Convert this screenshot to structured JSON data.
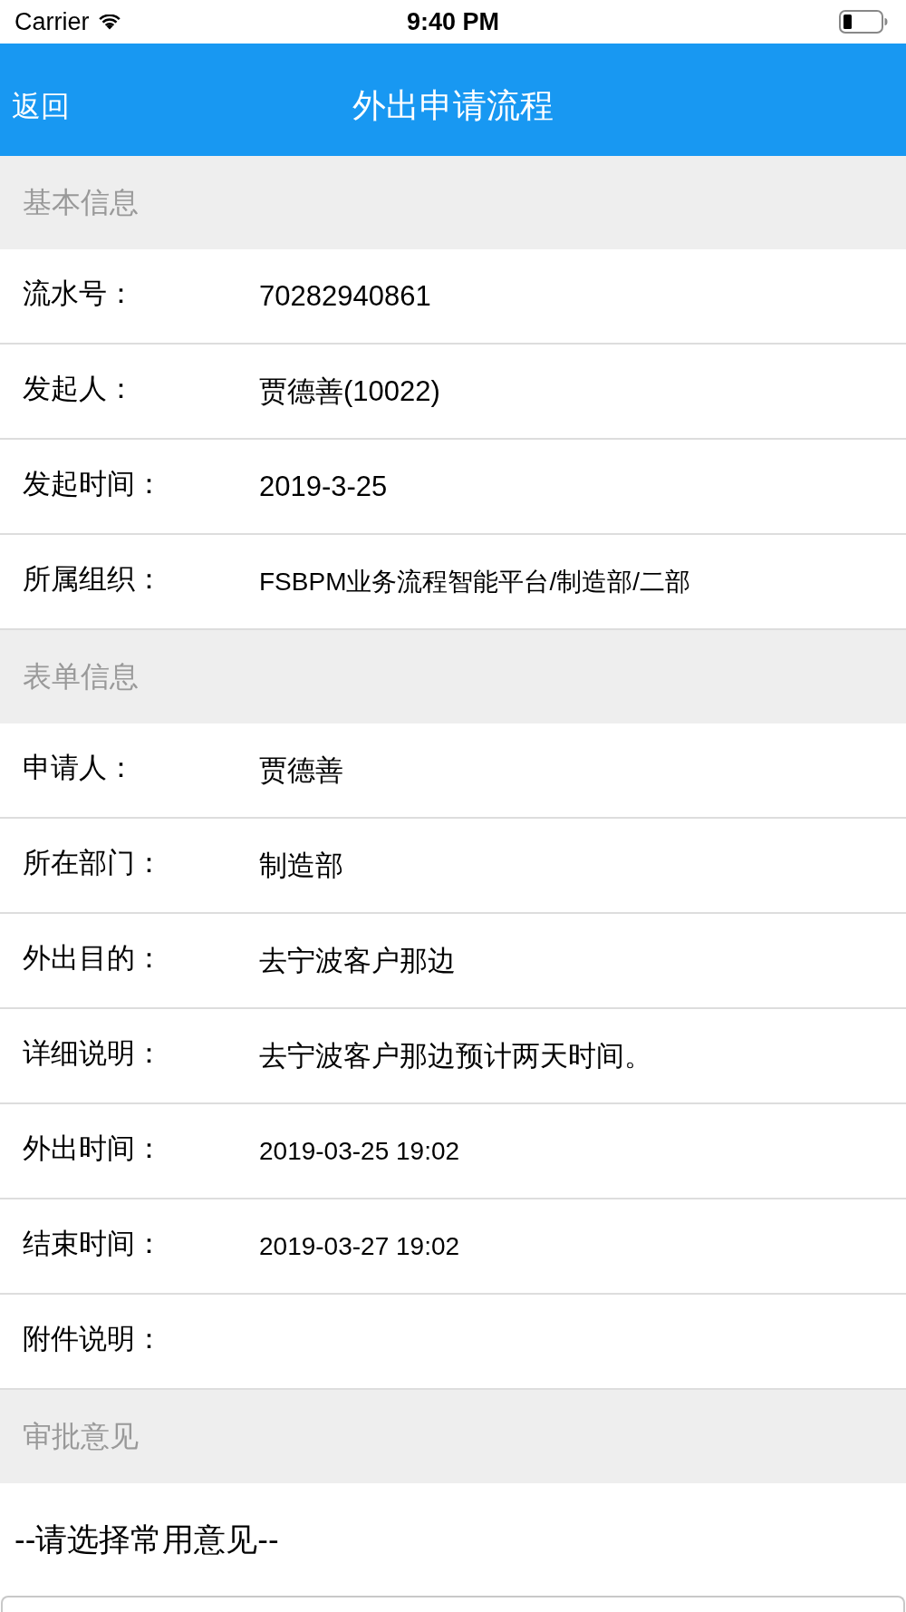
{
  "status_bar": {
    "carrier": "Carrier",
    "time": "9:40 PM"
  },
  "nav_bar": {
    "back": "返回",
    "title": "外出申请流程"
  },
  "sections": [
    {
      "title": "基本信息",
      "fields": [
        {
          "label": "流水号：",
          "value": "70282940861"
        },
        {
          "label": "发起人：",
          "value": "贾德善(10022)"
        },
        {
          "label": "发起时间：",
          "value": "2019-3-25"
        },
        {
          "label": "所属组织：",
          "value": "FSBPM业务流程智能平台/制造部/二部"
        }
      ]
    },
    {
      "title": "表单信息",
      "fields": [
        {
          "label": "申请人：",
          "value": "贾德善"
        },
        {
          "label": "所在部门：",
          "value": "制造部"
        },
        {
          "label": "外出目的：",
          "value": "去宁波客户那边"
        },
        {
          "label": "详细说明：",
          "value": "去宁波客户那边预计两天时间。"
        },
        {
          "label": "外出时间：",
          "value": "2019-03-25 19:02"
        },
        {
          "label": "结束时间：",
          "value": "2019-03-27 19:02"
        },
        {
          "label": "附件说明："
        }
      ]
    },
    {
      "title": "审批意见",
      "opinion_select": "--请选择常用意见--"
    }
  ]
}
